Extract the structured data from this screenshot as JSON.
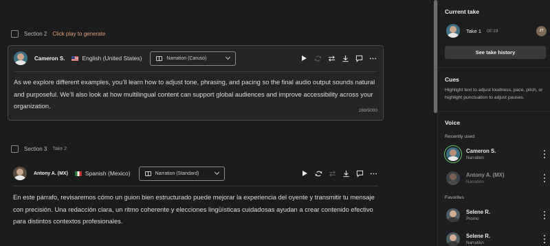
{
  "sections": [
    {
      "title": "Section 2",
      "hint": "Click play to generate"
    },
    {
      "title": "Section 3",
      "take": "Take 2"
    }
  ],
  "cards": [
    {
      "speaker": "Cameron S.",
      "language": "English (United States)",
      "style": "Narration (Caruso)",
      "text": "As we explore different examples, you’ll learn how to adjust tone, phrasing, and pacing so the final audio output sounds natural and purposeful. We’ll also look at how multilingual content can support global audiences and improve accessibility across your organization.",
      "char_count": "269/5000"
    },
    {
      "speaker": "Antony A. (MX)",
      "language": "Spanish (Mexico)",
      "style": "Narration (Standard)",
      "text": "En este párrafo, revisaremos cómo un guion bien estructurado puede mejorar la experiencia del oyente y transmitir tu mensaje con precisión. Una redacción clara, un ritmo coherente y elecciones lingüísticas cuidadosas ayudan a crear contenido efectivo para distintos contextos profesionales."
    }
  ],
  "panel": {
    "current_take": {
      "title": "Current take",
      "take_label": "Take 1",
      "duration": "00:19",
      "user_initials": "JT",
      "history_button": "See take history"
    },
    "cues": {
      "title": "Cues",
      "description": "Highlight text to adjust loudness, pace, pitch, or highlight punctuation to adjust pauses."
    },
    "voice": {
      "title": "Voice",
      "recently_used_label": "Recently used",
      "recently_used": [
        {
          "name": "Cameron S.",
          "style": "Narration",
          "selected": true
        },
        {
          "name": "Antony A. (MX)",
          "style": "Narration",
          "selected": false
        }
      ],
      "favorites_label": "Favorites",
      "favorites": [
        {
          "name": "Selene R.",
          "style": "Promo"
        },
        {
          "name": "Selene R.",
          "style": "Narration"
        }
      ]
    }
  },
  "colors": {
    "accent_hint": "#e0a07a",
    "selected_ring": "#61c46f",
    "background": "#1c1c1d"
  }
}
